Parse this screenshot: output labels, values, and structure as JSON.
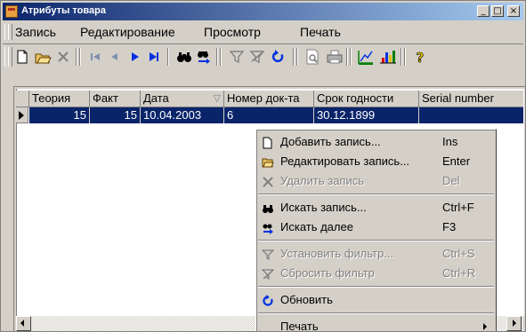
{
  "window": {
    "title": "Атрибуты товара",
    "controls": {
      "minimize": "_",
      "maximize": "□",
      "close": "×"
    }
  },
  "menubar": [
    "Запись",
    "Редактирование",
    "Просмотр",
    "Печать"
  ],
  "toolbar": [
    "new-record-icon",
    "edit-record-icon",
    "delete-record-icon",
    "first-record-icon",
    "prev-record-icon",
    "next-record-icon",
    "last-record-icon",
    "find-icon",
    "find-next-icon",
    "filter-icon",
    "clear-filter-icon",
    "refresh-icon",
    "print-preview-icon",
    "print-icon",
    "chart-edit-icon",
    "chart-icon",
    "help-icon"
  ],
  "grid": {
    "columns": [
      "Теория",
      "Факт",
      "Дата",
      "Номер док-та",
      "Срок годности",
      "Serial number"
    ],
    "sort_indicator": "▽",
    "rows": [
      [
        "15",
        "15",
        "10.04.2003",
        "6",
        "30.12.1899",
        ""
      ]
    ]
  },
  "context_menu": {
    "items": [
      {
        "icon": "document-icon",
        "label": "Добавить запись...",
        "shortcut": "Ins",
        "enabled": true
      },
      {
        "icon": "folder-open-icon",
        "label": "Редактировать запись...",
        "shortcut": "Enter",
        "enabled": true
      },
      {
        "icon": "cross-icon",
        "label": "Удалить запись",
        "shortcut": "Del",
        "enabled": false
      },
      {
        "icon": "binoculars-icon",
        "label": "Искать запись...",
        "shortcut": "Ctrl+F",
        "enabled": true
      },
      {
        "icon": "find-next-icon",
        "label": "Искать далее",
        "shortcut": "F3",
        "enabled": true
      },
      {
        "icon": "filter-icon",
        "label": "Установить фильтр...",
        "shortcut": "Ctrl+S",
        "enabled": false
      },
      {
        "icon": "clear-filter-icon",
        "label": "Сбросить фильтр",
        "shortcut": "Ctrl+R",
        "enabled": false
      },
      {
        "icon": "refresh-icon",
        "label": "Обновить",
        "shortcut": "",
        "enabled": true
      },
      {
        "icon": "",
        "label": "Печать",
        "shortcut": "",
        "enabled": true
      }
    ]
  },
  "colors": {
    "selection": "#0a246a",
    "title_gradient_start": "#0a246a",
    "title_gradient_end": "#a6caf0",
    "face": "#d4d0c8"
  }
}
